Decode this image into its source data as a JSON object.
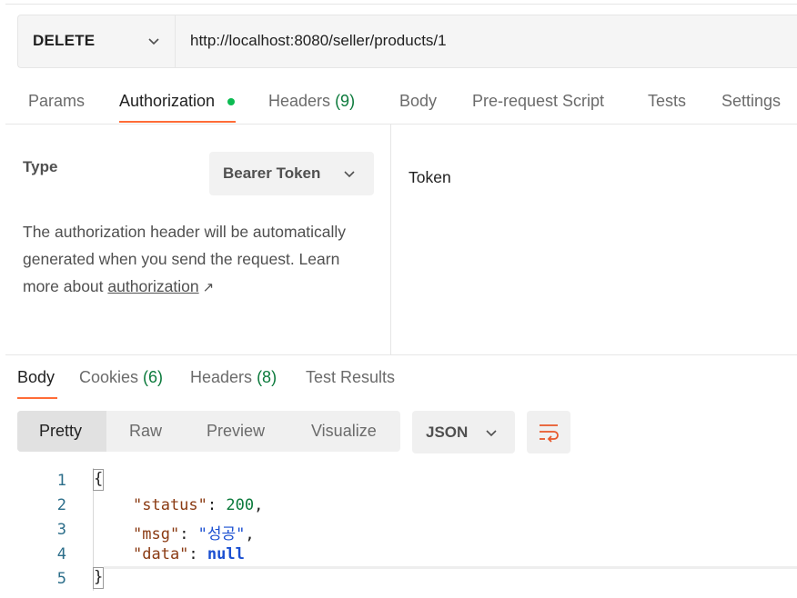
{
  "request": {
    "method": "DELETE",
    "url": "http://localhost:8080/seller/products/1"
  },
  "request_tabs": [
    {
      "label": "Params"
    },
    {
      "label": "Authorization",
      "active": true,
      "dot_color": "#0cbb52"
    },
    {
      "label": "Headers",
      "count": "(9)"
    },
    {
      "label": "Body"
    },
    {
      "label": "Pre-request Script"
    },
    {
      "label": "Tests"
    },
    {
      "label": "Settings"
    }
  ],
  "auth": {
    "type_label": "Type",
    "type_value": "Bearer Token",
    "description": "The authorization header will be automatically generated when you send the request. Learn more about",
    "learn_link": "authorization",
    "link_arrow": "↗",
    "token_label": "Token"
  },
  "response_tabs": [
    {
      "label": "Body",
      "active": true
    },
    {
      "label": "Cookies",
      "count": "(6)"
    },
    {
      "label": "Headers",
      "count": "(8)"
    },
    {
      "label": "Test Results"
    }
  ],
  "view_modes": [
    {
      "label": "Pretty",
      "active": true
    },
    {
      "label": "Raw"
    },
    {
      "label": "Preview"
    },
    {
      "label": "Visualize"
    }
  ],
  "format": "JSON",
  "icons": {
    "method_dropdown": "chevron-down-icon",
    "type_dropdown": "chevron-down-icon",
    "format_dropdown": "chevron-down-icon",
    "wrap": "wrap-lines-icon"
  },
  "colors": {
    "accent": "#ff6c37",
    "count_green": "#0c7a3c",
    "key": "#8a3a12",
    "number": "#0c7a3c",
    "string": "#1a4fd1"
  },
  "code": {
    "line_numbers": [
      "1",
      "2",
      "3",
      "4",
      "5"
    ],
    "open_brace": "{",
    "close_brace": "}",
    "lines": [
      {
        "key": "\"status\"",
        "sep": ": ",
        "value": "200",
        "trail": ","
      },
      {
        "key": "\"msg\"",
        "sep": ": ",
        "value": "\"성공\"",
        "trail": ","
      },
      {
        "key": "\"data\"",
        "sep": ": ",
        "value": "null",
        "trail": ""
      }
    ]
  }
}
